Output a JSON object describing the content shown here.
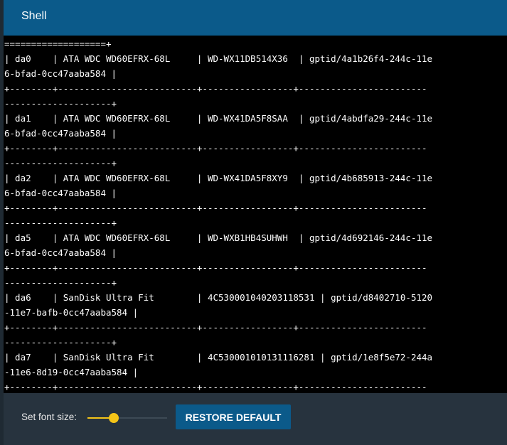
{
  "header": {
    "title": "Shell"
  },
  "terminal": {
    "lines": [
      "===================+",
      "| da0    | ATA WDC WD60EFRX-68L     | WD-WX11DB514X36  | gptid/4a1b26f4-244c-11e",
      "6-bfad-0cc47aaba584 |",
      "+--------+--------------------------+-----------------+------------------------",
      "--------------------+",
      "| da1    | ATA WDC WD60EFRX-68L     | WD-WX41DA5F8SAA  | gptid/4abdfa29-244c-11e",
      "6-bfad-0cc47aaba584 |",
      "+--------+--------------------------+-----------------+------------------------",
      "--------------------+",
      "| da2    | ATA WDC WD60EFRX-68L     | WD-WX41DA5F8XY9  | gptid/4b685913-244c-11e",
      "6-bfad-0cc47aaba584 |",
      "+--------+--------------------------+-----------------+------------------------",
      "--------------------+",
      "| da5    | ATA WDC WD60EFRX-68L     | WD-WXB1HB4SUHWH  | gptid/4d692146-244c-11e",
      "6-bfad-0cc47aaba584 |",
      "+--------+--------------------------+-----------------+------------------------",
      "--------------------+",
      "| da6    | SanDisk Ultra Fit        | 4C530001040203118531 | gptid/d8402710-5120",
      "-11e7-bafb-0cc47aaba584 |",
      "+--------+--------------------------+-----------------+------------------------",
      "--------------------+",
      "| da7    | SanDisk Ultra Fit        | 4C530001010131116281 | gptid/1e8f5e72-244a",
      "-11e6-8d19-0cc47aaba584 |",
      "+--------+--------------------------+-----------------+------------------------"
    ]
  },
  "footer": {
    "font_size_label": "Set font size:",
    "font_size_level": 0.33,
    "restore_label": "RESTORE DEFAULT"
  },
  "colors": {
    "header_bg": "#0b5a8a",
    "terminal_bg": "#000000",
    "terminal_fg": "#ffffff",
    "footer_bg": "#27333e",
    "accent": "#f5c518"
  }
}
